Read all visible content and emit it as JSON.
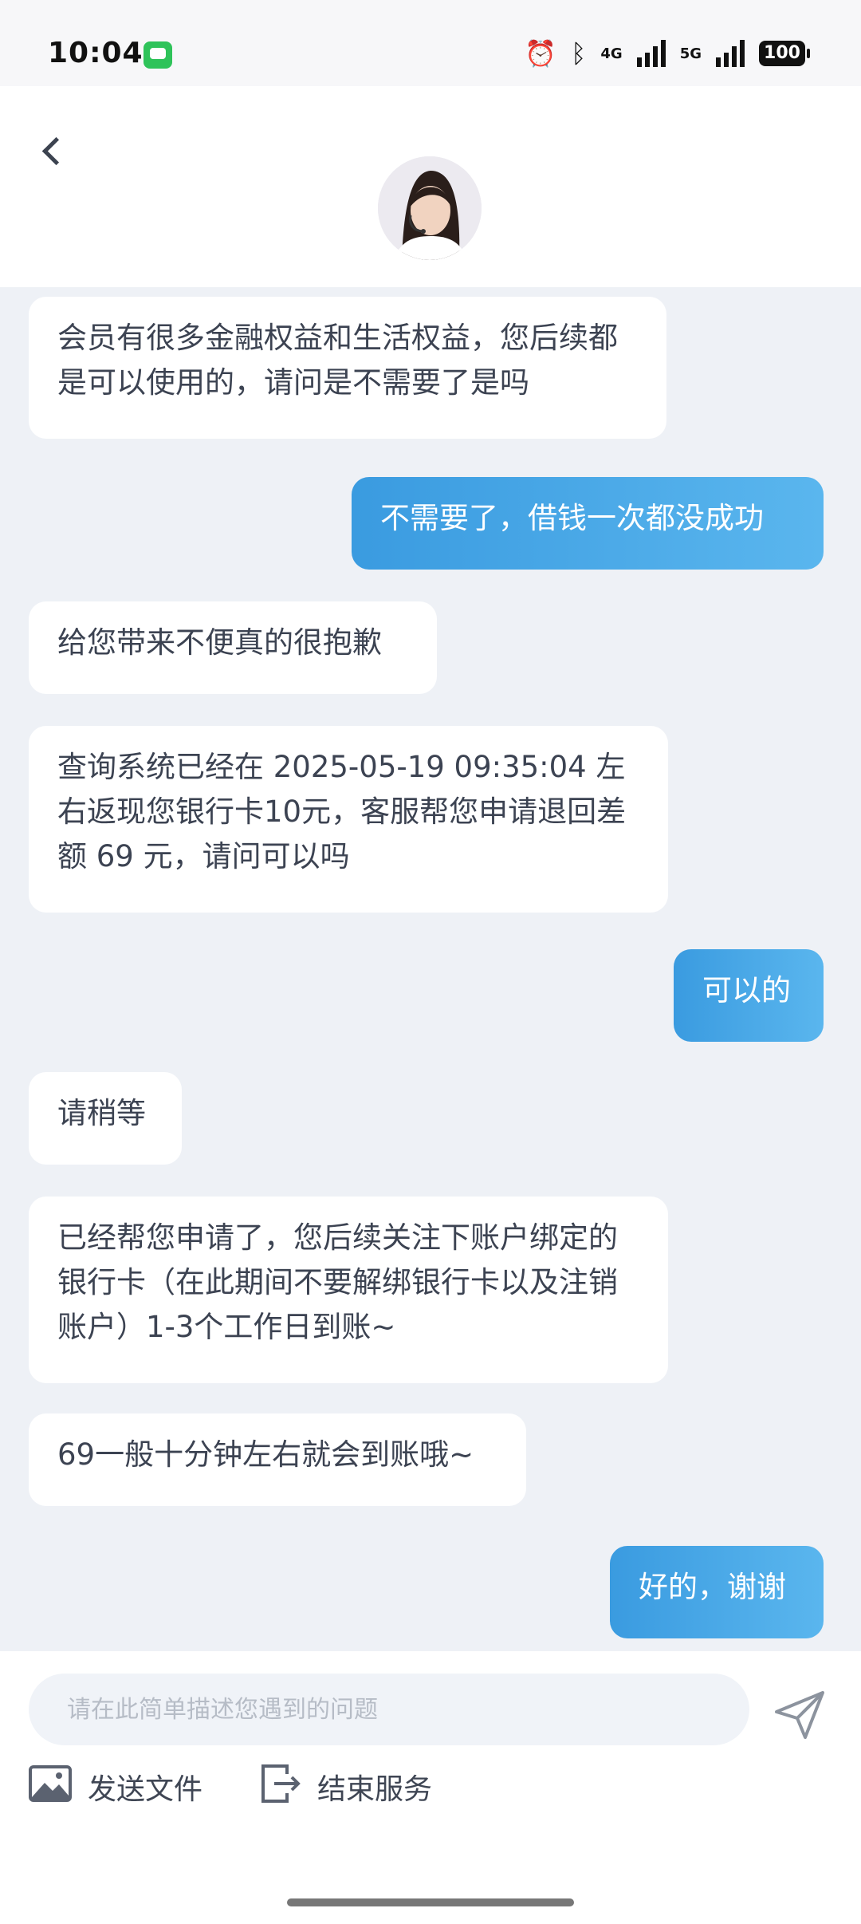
{
  "status_bar": {
    "time": "10:04",
    "network_1": "4G",
    "network_2": "5G",
    "battery": "100"
  },
  "header": {
    "avatar_icon": "customer-service-agent-avatar"
  },
  "messages": [
    {
      "side": "in",
      "text": "会员有很多金融权益和生活权益，您后续都是可以使用的，请问是不需要了是吗"
    },
    {
      "side": "out",
      "text": "不需要了，借钱一次都没成功"
    },
    {
      "side": "in",
      "text": "给您带来不便真的很抱歉"
    },
    {
      "side": "in",
      "text": "查询系统已经在 2025-05-19 09:35:04 左右返现您银行卡10元，客服帮您申请退回差额 69 元，请问可以吗"
    },
    {
      "side": "out",
      "text": "可以的"
    },
    {
      "side": "in",
      "text": "请稍等"
    },
    {
      "side": "in",
      "text": "已经帮您申请了，您后续关注下账户绑定的银行卡（在此期间不要解绑银行卡以及注销账户）1-3个工作日到账~"
    },
    {
      "side": "in",
      "text": "69一般十分钟左右就会到账哦~"
    },
    {
      "side": "out",
      "text": "好的，谢谢"
    }
  ],
  "input": {
    "placeholder": "请在此简单描述您遇到的问题",
    "value": ""
  },
  "tools": {
    "send_file": "发送文件",
    "end_service": "结束服务"
  },
  "colors": {
    "outgoing_bubble": "#3a9be0",
    "chat_background": "#eef1f6"
  }
}
